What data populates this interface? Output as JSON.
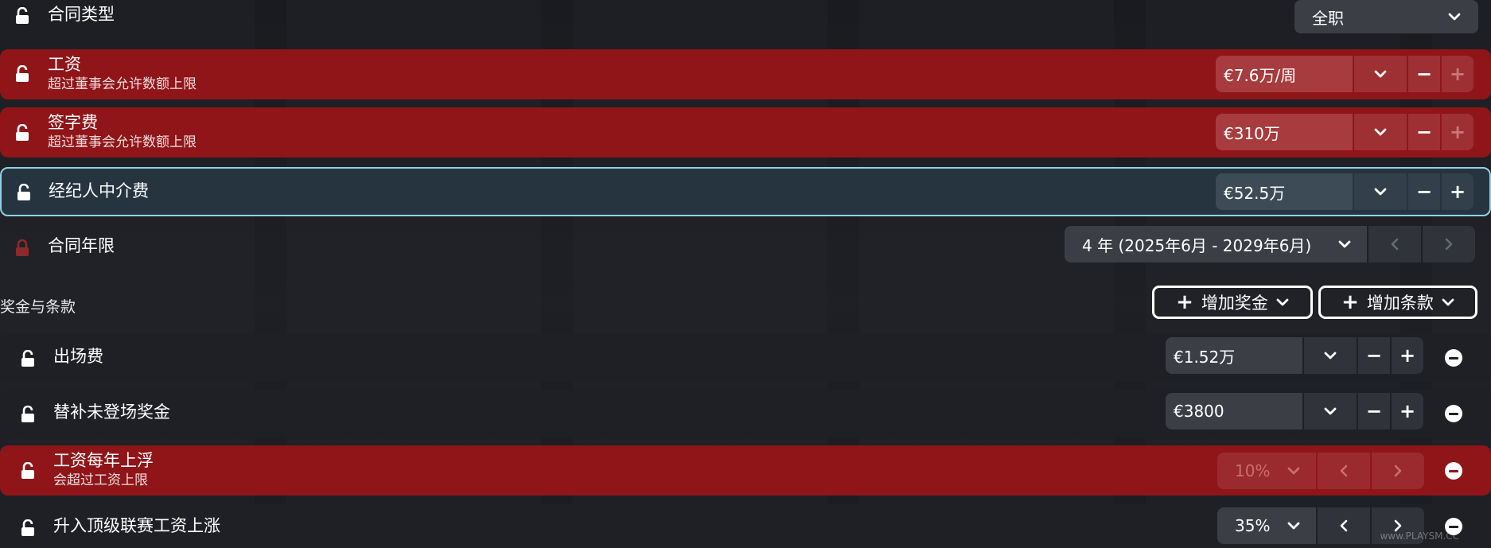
{
  "contract_type": {
    "label": "合同类型",
    "value": "全职"
  },
  "wage": {
    "label": "工资",
    "warning": "超过董事会允许数额上限",
    "value": "€7.6万/周"
  },
  "signing_fee": {
    "label": "签字费",
    "warning": "超过董事会允许数额上限",
    "value": "€310万"
  },
  "agent_fee": {
    "label": "经纪人中介费",
    "value": "€52.5万"
  },
  "contract_length": {
    "label": "合同年限",
    "value": "4 年 (2025年6月 - 2029年6月)"
  },
  "bonuses_section": {
    "title": "奖金与条款",
    "add_bonus_label": "增加奖金",
    "add_clause_label": "增加条款"
  },
  "bonuses": [
    {
      "label": "出场费",
      "value": "€1.52万"
    },
    {
      "label": "替补未登场奖金",
      "value": "€3800"
    }
  ],
  "yearly_rise": {
    "label": "工资每年上浮",
    "warning": "会超过工资上限",
    "value": "10%"
  },
  "promotion_rise": {
    "label": "升入顶级联赛工资上涨",
    "value": "35%"
  },
  "watermark": "www.PLAYSM.CC",
  "colors": {
    "red_row": "#8f1519",
    "highlight_border": "#8fd2e6",
    "dark_row": "#1e2026"
  },
  "icons": [
    "lock-open-icon",
    "lock-closed-icon",
    "chevron-down-icon",
    "chevron-left-icon",
    "chevron-right-icon",
    "minus-icon",
    "plus-icon",
    "remove-circle-icon"
  ]
}
